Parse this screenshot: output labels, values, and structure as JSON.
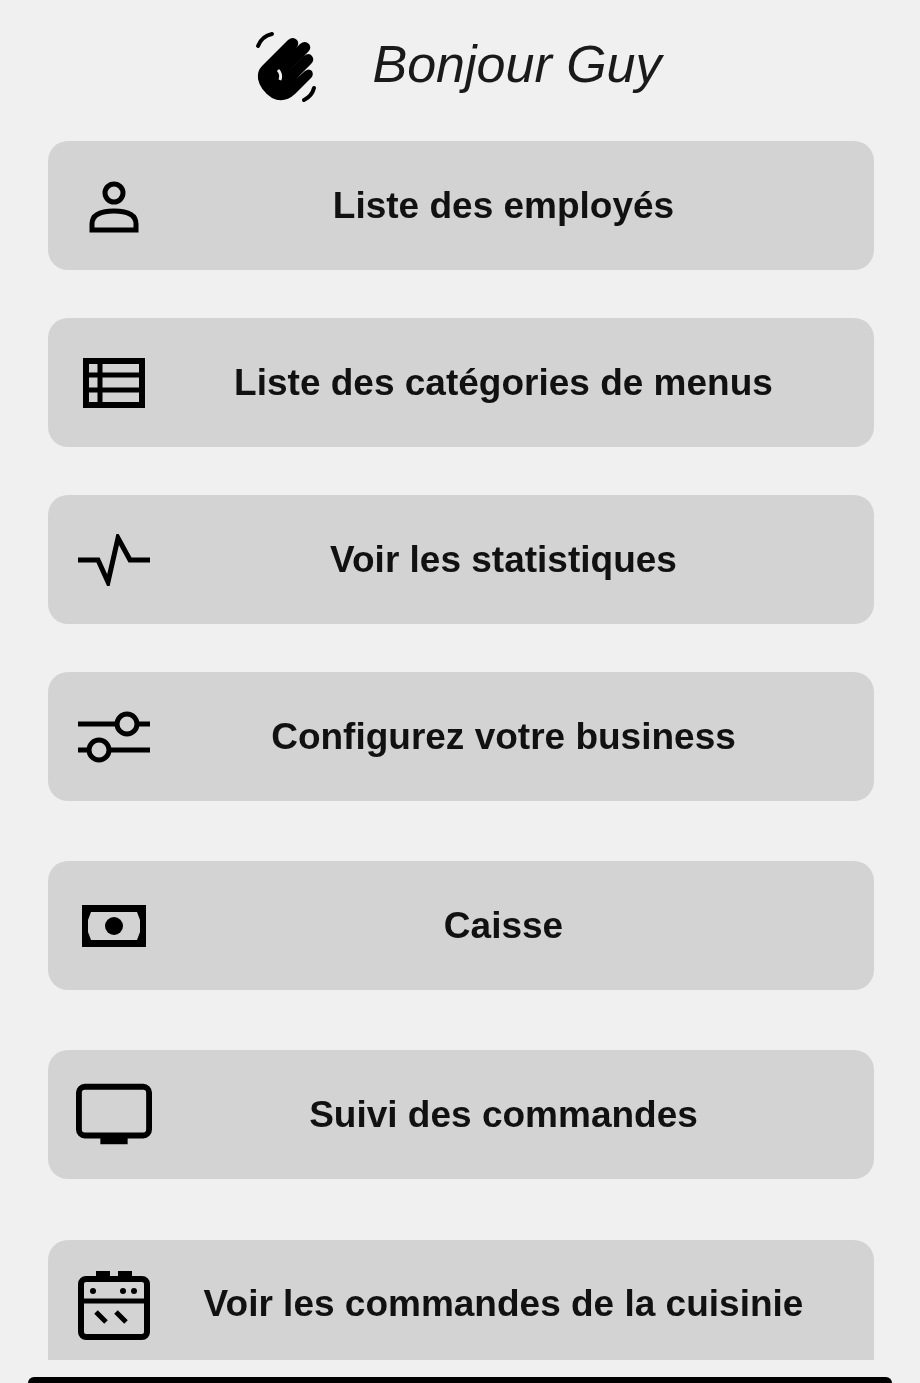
{
  "greeting": "Bonjour Guy",
  "menu": [
    {
      "label": "Liste des employés"
    },
    {
      "label": "Liste des catégories de menus"
    },
    {
      "label": "Voir les statistiques"
    },
    {
      "label": "Configurez votre business"
    },
    {
      "label": "Caisse"
    },
    {
      "label": "Suivi des commandes"
    },
    {
      "label": "Voir les commandes de la cuisinie"
    }
  ]
}
